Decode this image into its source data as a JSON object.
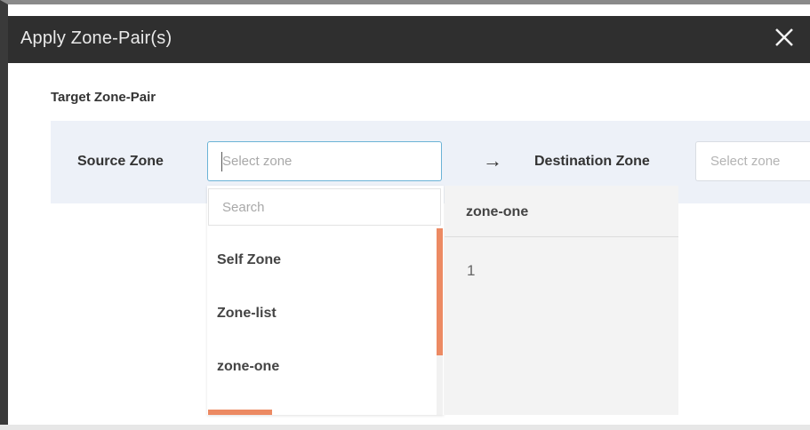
{
  "dialog": {
    "title": "Apply Zone-Pair(s)",
    "close_icon": "close-icon"
  },
  "target": {
    "section_label": "Target Zone-Pair",
    "source_label": "Source Zone",
    "source_placeholder": "Select zone",
    "arrow": "→",
    "destination_label": "Destination Zone",
    "destination_placeholder": "Select zone"
  },
  "dropdown": {
    "search_placeholder": "Search",
    "items": [
      {
        "label": "Self Zone"
      },
      {
        "label": "Zone-list"
      },
      {
        "label": "zone-one"
      }
    ]
  },
  "preview": {
    "title": "zone-one",
    "value": "1"
  },
  "colors": {
    "header_bg": "#2f2f2f",
    "band_bg": "#edf1f8",
    "accent": "#ec8a63",
    "focus_border": "#6bb3d6"
  }
}
